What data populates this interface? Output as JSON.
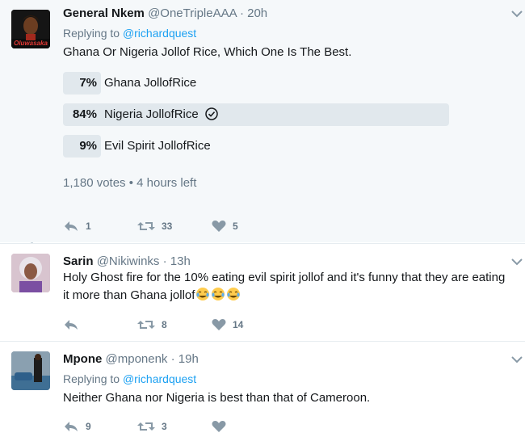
{
  "tweets": [
    {
      "name": "General Nkem",
      "handle": "@OneTripleAAA",
      "sep": "·",
      "time": "20h",
      "replying_prefix": "Replying to",
      "replying_to": "@richardquest",
      "text": "Ghana Or Nigeria Jollof Rice, Which One Is The Best.",
      "avatar_text": "Oluwasaka",
      "poll": {
        "options": [
          {
            "percent": "7%",
            "value": 7,
            "label": "Ghana JollofRice",
            "winner": false
          },
          {
            "percent": "84%",
            "value": 84,
            "label": "Nigeria JollofRice",
            "winner": true
          },
          {
            "percent": "9%",
            "value": 9,
            "label": "Evil Spirit JollofRice",
            "winner": false
          }
        ],
        "votes": "1,180 votes",
        "bullet": "•",
        "time_left": "4 hours left"
      },
      "replies": "1",
      "retweets": "33",
      "likes": "5"
    },
    {
      "name": "Sarin",
      "handle": "@Nikiwinks",
      "sep": "·",
      "time": "13h",
      "text_line1": "Holy Ghost fire for the 10% eating evil spirit jollof and it's funny that they are eating",
      "text_line2": "it more than Ghana jollof",
      "emoji_name": "face-with-tears-of-joy",
      "replies": "",
      "retweets": "8",
      "likes": "14"
    },
    {
      "name": "Mpone",
      "handle": "@mponenk",
      "sep": "·",
      "time": "19h",
      "replying_prefix": "Replying to",
      "replying_to": "@richardquest",
      "text": "Neither Ghana nor Nigeria is best than that of Cameroon.",
      "replies": "9",
      "retweets": "3",
      "likes": ""
    }
  ],
  "colors": {
    "accent": "#1da1f2",
    "muted": "#657786",
    "thread_line": "#ccd6dd",
    "poll_bar": "#e1e8ed",
    "selected_bg": "#f5f8fa"
  }
}
